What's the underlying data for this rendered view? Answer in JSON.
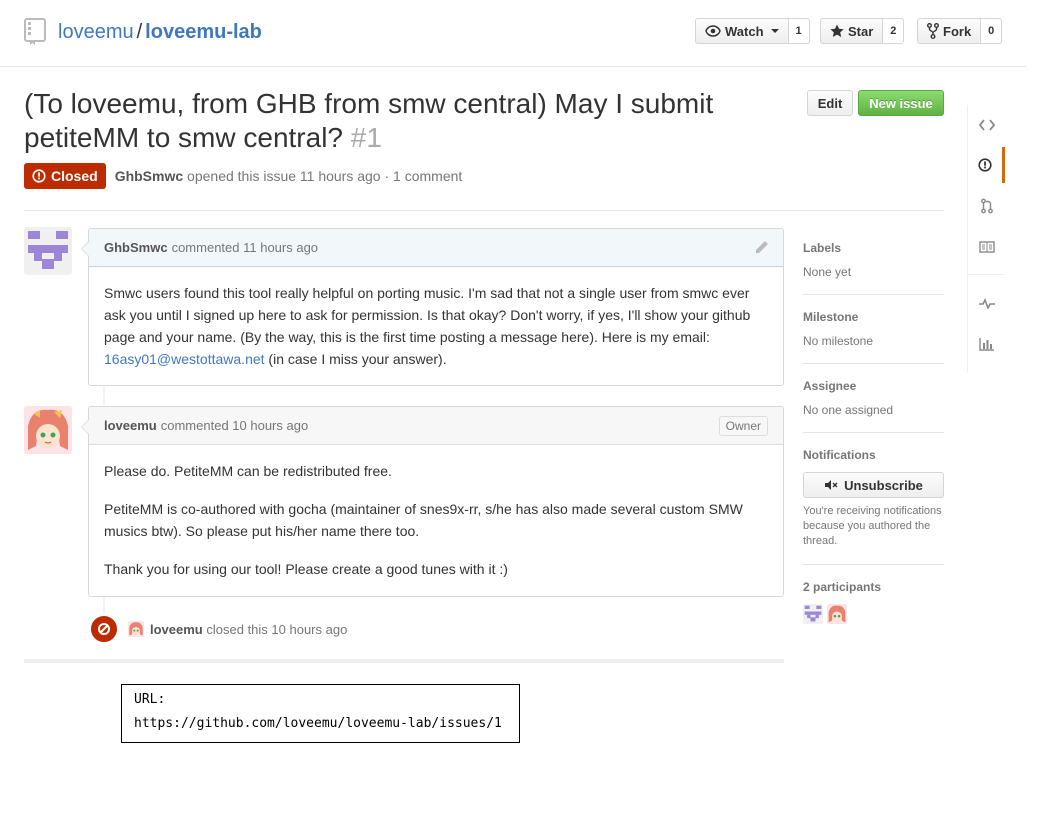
{
  "repo": {
    "owner": "loveemu",
    "separator": "/",
    "name": "loveemu-lab"
  },
  "actions": {
    "watch": {
      "label": "Watch",
      "count": "1"
    },
    "star": {
      "label": "Star",
      "count": "2"
    },
    "fork": {
      "label": "Fork",
      "count": "0"
    }
  },
  "issue": {
    "title": "(To loveemu, from GHB from smw central) May I submit petiteMM to smw central?",
    "number": "#1",
    "edit_label": "Edit",
    "new_issue_label": "New issue",
    "state": "Closed",
    "author": "GhbSmwc",
    "meta": "opened this issue 11 hours ago · 1 comment"
  },
  "comments": [
    {
      "author": "GhbSmwc",
      "meta": "commented 11 hours ago",
      "body_pre": "Smwc users found this tool really helpful on porting music. I'm sad that not a single user from smwc ever ask you until I signed up here to ask for permission. Is that okay? Don't worry, if yes, I'll show your github page and your name. (By the way, this is the first time posting a message here). Here is my email: ",
      "email": "16asy01@westottawa.net",
      "body_post": " (in case I miss your answer)."
    },
    {
      "author": "loveemu",
      "meta": "commented 10 hours ago",
      "badge": "Owner",
      "paragraphs": [
        "Please do. PetiteMM can be redistributed free.",
        "PetiteMM is co-authored with gocha (maintainer of snes9x-rr, s/he has also made several custom SMW musics btw). So please put his/her name there too.",
        "Thank you for using our tool! Please create a good tunes with it :)"
      ]
    }
  ],
  "event": {
    "actor": "loveemu",
    "text": "closed this 10 hours ago"
  },
  "sidebar": {
    "labels": {
      "heading": "Labels",
      "value": "None yet"
    },
    "milestone": {
      "heading": "Milestone",
      "value": "No milestone"
    },
    "assignee": {
      "heading": "Assignee",
      "value": "No one assigned"
    },
    "notifications": {
      "heading": "Notifications",
      "button": "Unsubscribe",
      "reason": "You're receiving notifications because you authored the thread."
    },
    "participants": {
      "heading": "2 participants"
    }
  },
  "url_box": {
    "label": "URL:",
    "value": "https://github.com/loveemu/loveemu-lab/issues/1"
  },
  "colors": {
    "link": "#4078c0",
    "closed": "#bd2c00",
    "new_issue": "#60b044",
    "nav_selected": "#d26911"
  }
}
